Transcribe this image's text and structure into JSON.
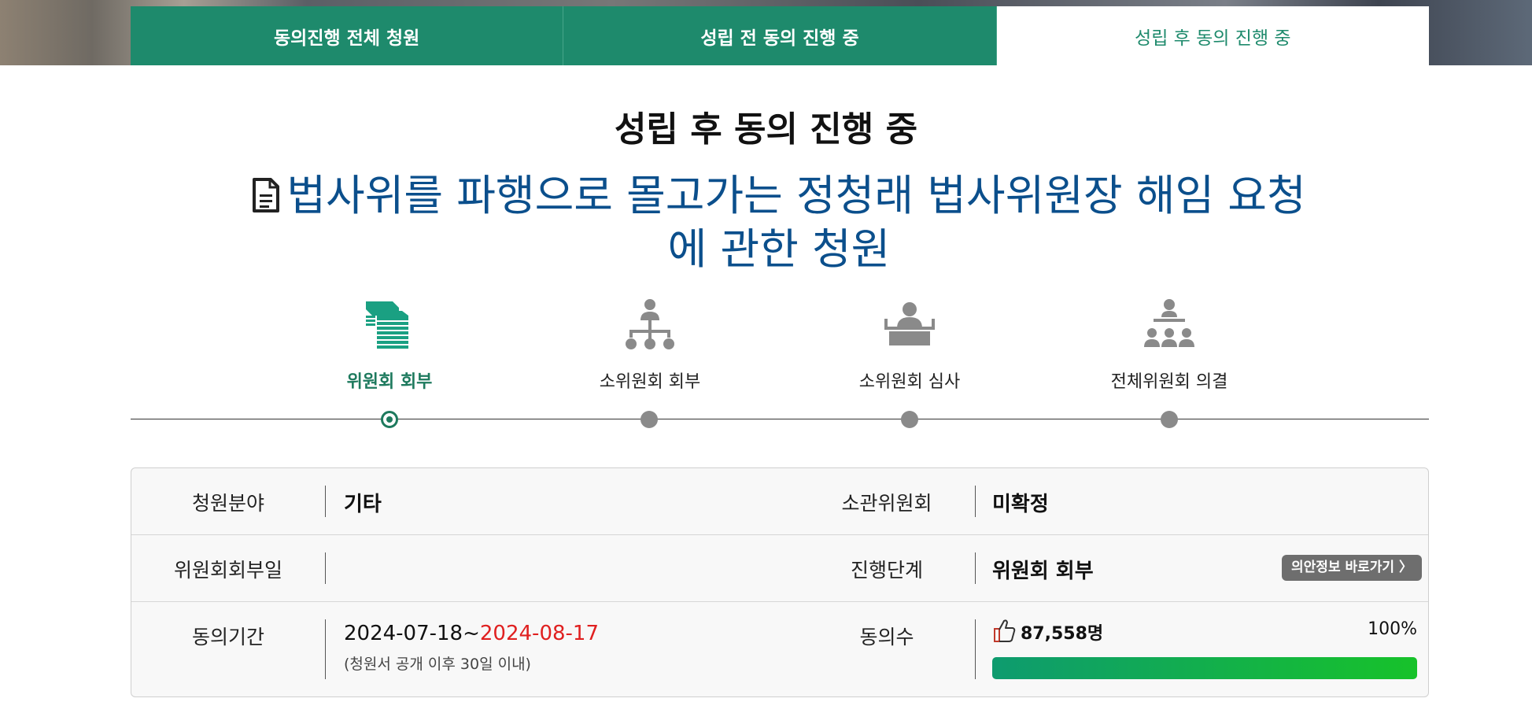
{
  "tabs": [
    {
      "label": "동의진행 전체 청원",
      "active": false
    },
    {
      "label": "성립 전 동의 진행 중",
      "active": false
    },
    {
      "label": "성립 후 동의 진행 중",
      "active": true
    }
  ],
  "section_title": "성립 후 동의 진행 중",
  "petition": {
    "title_line1": "법사위를 파행으로 몰고가는 정청래 법사위원장 해임 요청",
    "title_line2": "에 관한 청원",
    "icon": "document-icon"
  },
  "steps": [
    {
      "label": "위원회 회부",
      "icon": "stacked-documents-icon",
      "active": true
    },
    {
      "label": "소위원회 회부",
      "icon": "org-chart-person-icon",
      "active": false
    },
    {
      "label": "소위원회 심사",
      "icon": "person-at-desk-icon",
      "active": false
    },
    {
      "label": "전체위원회 의결",
      "icon": "audience-meeting-icon",
      "active": false
    }
  ],
  "info": {
    "field_label": "청원분야",
    "field_value": "기타",
    "committee_label": "소관위원회",
    "committee_value": "미확정",
    "referral_date_label": "위원회회부일",
    "referral_date_value": "",
    "stage_label": "진행단계",
    "stage_value": "위원회 회부",
    "bill_info_link": "의안정보 바로가기 〉",
    "period_label": "동의기간",
    "period_start": "2024-07-18~",
    "period_end": "2024-08-17",
    "period_note": "(청원서 공개 이후 30일 이내)",
    "agree_label": "동의수",
    "agree_count": "87,558명",
    "agree_percent": "100%",
    "agree_progress": 1.0
  },
  "colors": {
    "brand_green": "#1e8a6c",
    "title_blue": "#0b4f8c",
    "deadline_red": "#e02020"
  }
}
